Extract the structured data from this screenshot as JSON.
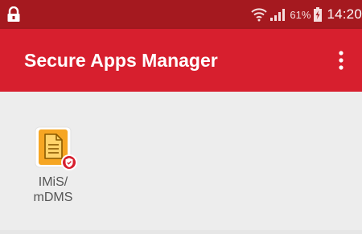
{
  "status_bar": {
    "battery_percent": "61%",
    "time": "14:20",
    "lock_icon": "lock-icon",
    "wifi_icon": "wifi-icon",
    "signal_icon": "signal-icon",
    "battery_icon": "battery-charging-icon"
  },
  "app_bar": {
    "title": "Secure Apps Manager",
    "menu_icon": "more-vert-icon",
    "color": "#d71f2e"
  },
  "apps": [
    {
      "label": "IMiS/\nmDMS",
      "icon": "document-icon",
      "badge_icon": "shield-badge-icon"
    }
  ],
  "colors": {
    "status_bar": "#a5191f",
    "app_bar": "#d71f2e",
    "background": "#ededed",
    "icon_orange": "#f6a623"
  }
}
